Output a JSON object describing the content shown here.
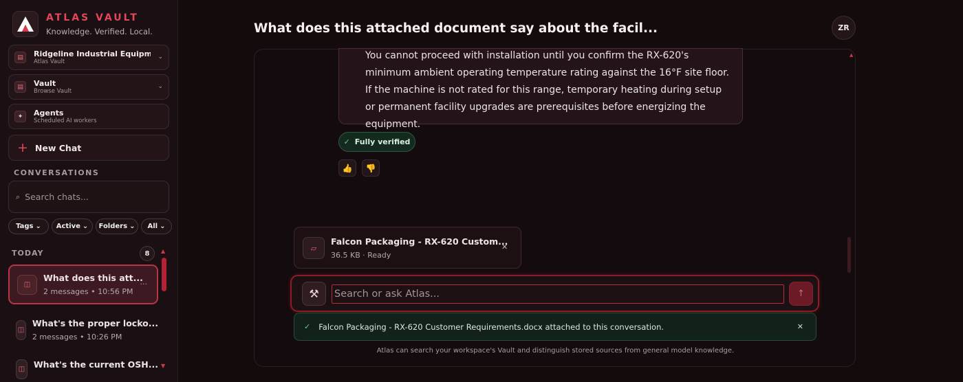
{
  "brand": {
    "name": "ATLAS VAULT",
    "tagline": "Knowledge. Verified. Local."
  },
  "sidebar": {
    "workspace": {
      "title": "Ridgeline Industrial Equipme...",
      "subtitle": "Atlas Vault"
    },
    "vault": {
      "title": "Vault",
      "subtitle": "Browse Vault"
    },
    "agents": {
      "title": "Agents",
      "subtitle": "Scheduled AI workers"
    },
    "new_chat": "New Chat",
    "conversations_label": "CONVERSATIONS",
    "search_placeholder": "Search chats...",
    "filters": [
      "Tags",
      "Active",
      "Folders",
      "All"
    ],
    "group_label": "TODAY",
    "group_count": "8",
    "conversations": [
      {
        "title": "What does this att...",
        "meta": "2 messages • 10:56 PM",
        "active": true
      },
      {
        "title": "What's the proper locko...",
        "meta": "2 messages • 10:26 PM",
        "active": false
      },
      {
        "title": "What's the current OSH...",
        "meta": "",
        "active": false
      }
    ]
  },
  "header": {
    "title": "What does this attached document say about the facil...",
    "avatar": "ZR"
  },
  "message": {
    "text": "You cannot proceed with installation until you confirm the RX-620's minimum ambient operating temperature rating against the 16°F site floor. If the machine is not rated for this range, temporary heating during setup or permanent facility upgrades are prerequisites before energizing the equipment.",
    "verified_label": "Fully verified"
  },
  "attachment": {
    "name": "Falcon Packaging - RX-620 Custom...",
    "meta": "36.5 KB · Ready"
  },
  "composer": {
    "placeholder": "Search or ask Atlas..."
  },
  "toast": {
    "text": "Falcon Packaging - RX-620 Customer Requirements.docx attached to this conversation."
  },
  "footer": "Atlas can search your workspace's Vault and distinguish stored sources from general model knowledge.",
  "colors": {
    "accent": "#e0475a",
    "background": "#140b0d",
    "success": "#72c58f"
  }
}
